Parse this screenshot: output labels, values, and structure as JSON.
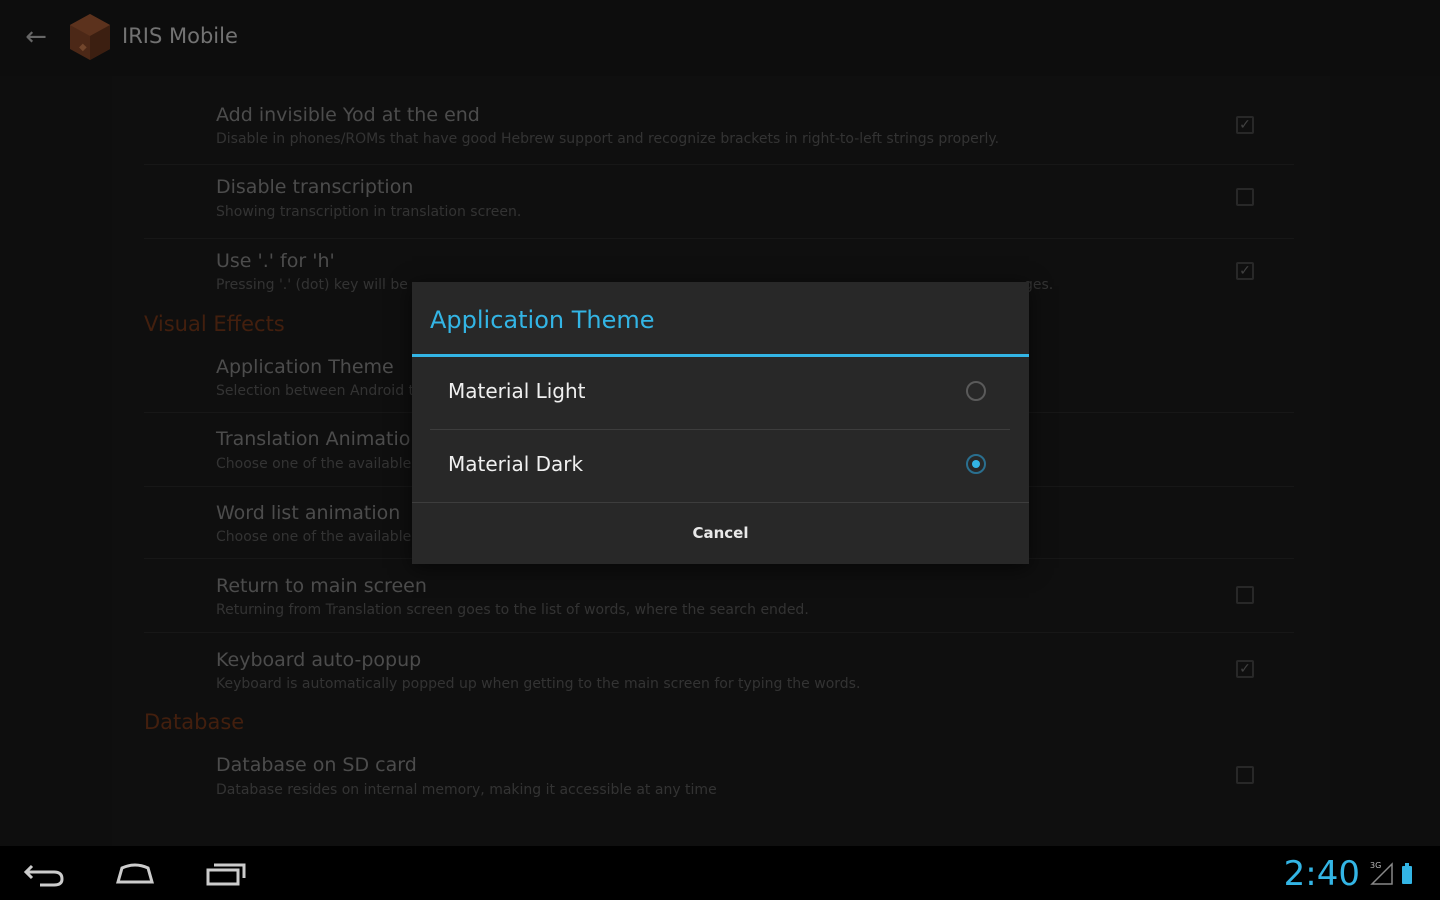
{
  "action_bar": {
    "title": "IRIS Mobile"
  },
  "preferences": [
    {
      "title": "Add invisible Yod at the end",
      "summary": "Disable in phones/ROMs that have good Hebrew support and recognize brackets in right-to-left strings properly.",
      "checked": true
    },
    {
      "title": "Disable transcription",
      "summary": "Showing transcription in translation screen.",
      "checked": false
    },
    {
      "title": "Use '.' for 'h'",
      "summary": "Pressing '.' (dot) key will be ",
      "summary_tail": "ges.",
      "checked": true
    }
  ],
  "category_visual": "Visual Effects",
  "visual_prefs": [
    {
      "title": "Application Theme",
      "summary": "Selection between Android t"
    },
    {
      "title": "Translation Animation",
      "summary": "Choose one of the available"
    },
    {
      "title": "Word list animation",
      "summary": "Choose one of the available"
    },
    {
      "title": "Return to main screen",
      "summary": "Returning from Translation screen goes to the list of words, where the search ended.",
      "checked": false
    },
    {
      "title": "Keyboard auto-popup",
      "summary": "Keyboard is automatically popped up when getting to the main screen for typing the words.",
      "checked": true
    }
  ],
  "category_database": "Database",
  "database_prefs": [
    {
      "title": "Database on SD card",
      "summary": "Database resides on internal memory, making it accessible at any time",
      "checked": false
    }
  ],
  "dialog": {
    "title": "Application Theme",
    "options": [
      {
        "label": "Material Light",
        "selected": false
      },
      {
        "label": "Material Dark",
        "selected": true
      }
    ],
    "cancel_label": "Cancel"
  },
  "nav_bar": {
    "clock": "2:40",
    "network": "3G"
  },
  "colors": {
    "accent": "#33b5e5",
    "category": "#7a3a1a",
    "background": "#1a1a1a"
  }
}
